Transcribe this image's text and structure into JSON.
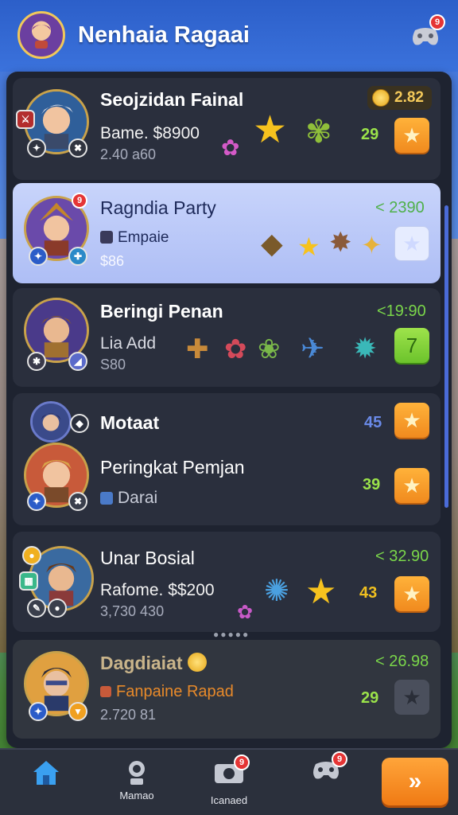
{
  "app": {
    "title": "Nenhaia Ragaai",
    "header_badge": "9"
  },
  "cards": [
    {
      "title": "Seojzidan Fainal",
      "sub": "Bame. $8900",
      "sub2": "2.40 a60",
      "coin_value": "2.82",
      "score": "29",
      "badge_left": "⚔"
    },
    {
      "title": "Ragndia Party",
      "sub": "Empaie",
      "sub2": "$86",
      "score": "< 2390",
      "badge": "9"
    },
    {
      "title": "Beringi Penan",
      "sub": "Lia Add",
      "sub2": "S80",
      "score": "<19:90",
      "action": "7"
    },
    {
      "title": "Motaat",
      "score": "45",
      "title2": "Peringkat Pemjan",
      "sub": "Darai",
      "score2": "39"
    },
    {
      "title": "Unar Bosial",
      "sub": "Rafome. $$200",
      "sub2": "3,730 430",
      "score": "< 32.90",
      "score_side": "43"
    },
    {
      "title": "Dagdiaiat",
      "sub": "Fanpaine Rapad",
      "sub2": "2.720 81",
      "score": "< 26.98",
      "score2": "29"
    }
  ],
  "bottom_nav": {
    "items": [
      {
        "label": ""
      },
      {
        "label": "Mamao"
      },
      {
        "label": "Icanaed",
        "badge": "9"
      },
      {
        "label": "",
        "badge": "9"
      }
    ],
    "go_label": "»"
  },
  "colors": {
    "header": "#2c5fc9",
    "panel": "#1e2330",
    "card": "#2a2f3d",
    "selected_card": "#c8d4fb",
    "score_green": "#7ad64a",
    "score_blue": "#4a6bd8",
    "accent_orange": "#f08a1e"
  }
}
